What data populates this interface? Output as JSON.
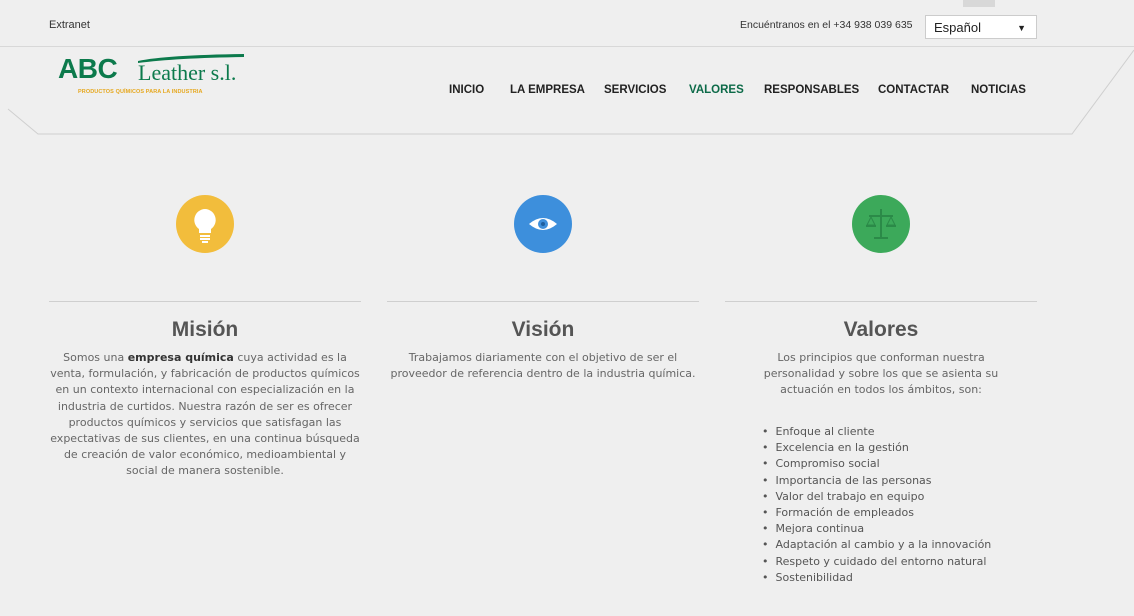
{
  "topbar": {
    "extranet": "Extranet",
    "contact": "Encuéntranos en el +34 938 039 635",
    "language": "Español"
  },
  "logo": {
    "abc": "ABC",
    "leather": "Leather s.l.",
    "tagline": "PRODUCTOS QUÍMICOS PARA LA INDUSTRIA"
  },
  "nav": {
    "items": [
      "INICIO",
      "LA EMPRESA",
      "SERVICIOS",
      "VALORES",
      "RESPONSABLES",
      "CONTACTAR",
      "NOTICIAS"
    ],
    "active": "VALORES"
  },
  "colors": {
    "brand_green": "#0c7a4c",
    "brand_yellow": "#e6a81f",
    "mision_icon": "#f2bd3c",
    "vision_icon": "#3d8fdc",
    "valores_icon": "#3ca95a"
  },
  "mision": {
    "icon": "lightbulb-icon",
    "title": "Misión",
    "text_before": "Somos una ",
    "text_bold": "empresa química",
    "text_after": " cuya actividad es la venta, formulación, y fabricación de productos químicos en un contexto internacional con especialización en la industria de curtidos. Nuestra razón de ser es ofrecer productos químicos y servicios que satisfagan las expectativas de sus clientes, en una continua búsqueda de creación de valor económico, medioambiental y social de manera sostenible."
  },
  "vision": {
    "icon": "eye-icon",
    "title": "Visión",
    "text": "Trabajamos diariamente con el objetivo de ser el proveedor de referencia dentro de la industria química."
  },
  "valores": {
    "icon": "scales-icon",
    "title": "Valores",
    "text": "Los principios que conforman nuestra personalidad y sobre los que se asienta su actuación en todos los ámbitos, son:",
    "list": [
      "Enfoque al cliente",
      "Excelencia en la gestión",
      "Compromiso social",
      "Importancia de las personas",
      "Valor del trabajo en equipo",
      "Formación de empleados",
      "Mejora continua",
      "Adaptación al cambio y a la innovación",
      "Respeto y cuidado del entorno natural",
      "Sostenibilidad"
    ]
  }
}
